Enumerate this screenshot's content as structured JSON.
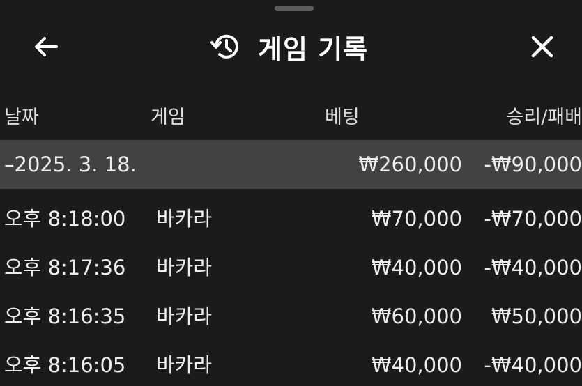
{
  "header": {
    "title": "게임 기록",
    "back_icon": "arrow-left-icon",
    "history_icon": "history-icon",
    "close_icon": "close-icon"
  },
  "columns": {
    "date": "날짜",
    "game": "게임",
    "bet": "베팅",
    "result": "승리/패배"
  },
  "group": {
    "date": "–2025. 3. 18.",
    "bet": "₩260,000",
    "result": "-₩90,000"
  },
  "rows": [
    {
      "time": "오후 8:18:00",
      "game": "바카라",
      "bet": "₩70,000",
      "result": "-₩70,000"
    },
    {
      "time": "오후 8:17:36",
      "game": "바카라",
      "bet": "₩40,000",
      "result": "-₩40,000"
    },
    {
      "time": "오후 8:16:35",
      "game": "바카라",
      "bet": "₩60,000",
      "result": "₩50,000"
    },
    {
      "time": "오후 8:16:05",
      "game": "바카라",
      "bet": "₩40,000",
      "result": "-₩40,000"
    }
  ]
}
